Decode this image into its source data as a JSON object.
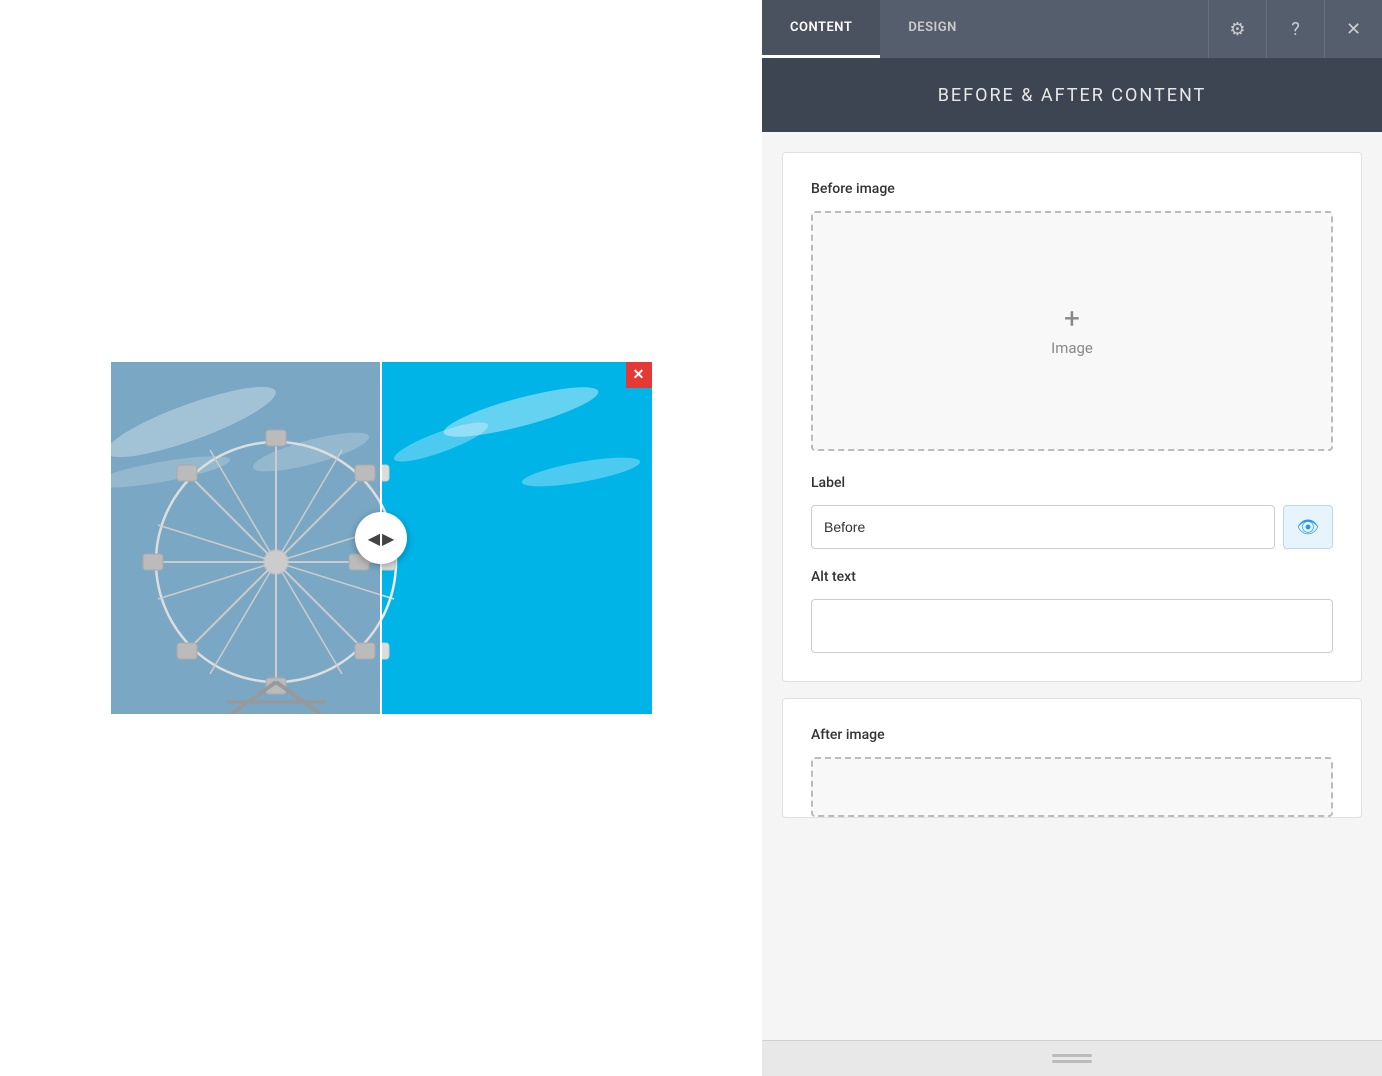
{
  "header": {
    "tabs": [
      {
        "id": "content",
        "label": "CONTENT",
        "active": true
      },
      {
        "id": "design",
        "label": "DESIGN",
        "active": false
      }
    ],
    "icons": {
      "settings": "⚙",
      "help": "?",
      "close": "✕"
    }
  },
  "section_title": "BEFORE & AFTER CONTENT",
  "before_card": {
    "image_label": "Before image",
    "upload_icon": "+",
    "upload_text": "Image",
    "label_field": {
      "label": "Label",
      "value": "Before",
      "placeholder": ""
    },
    "alt_text_field": {
      "label": "Alt text",
      "value": "",
      "placeholder": ""
    }
  },
  "after_card": {
    "image_label": "After image"
  },
  "preview": {
    "close_icon": "✕",
    "slider_left_arrow": "◀",
    "slider_right_arrow": "▶"
  }
}
